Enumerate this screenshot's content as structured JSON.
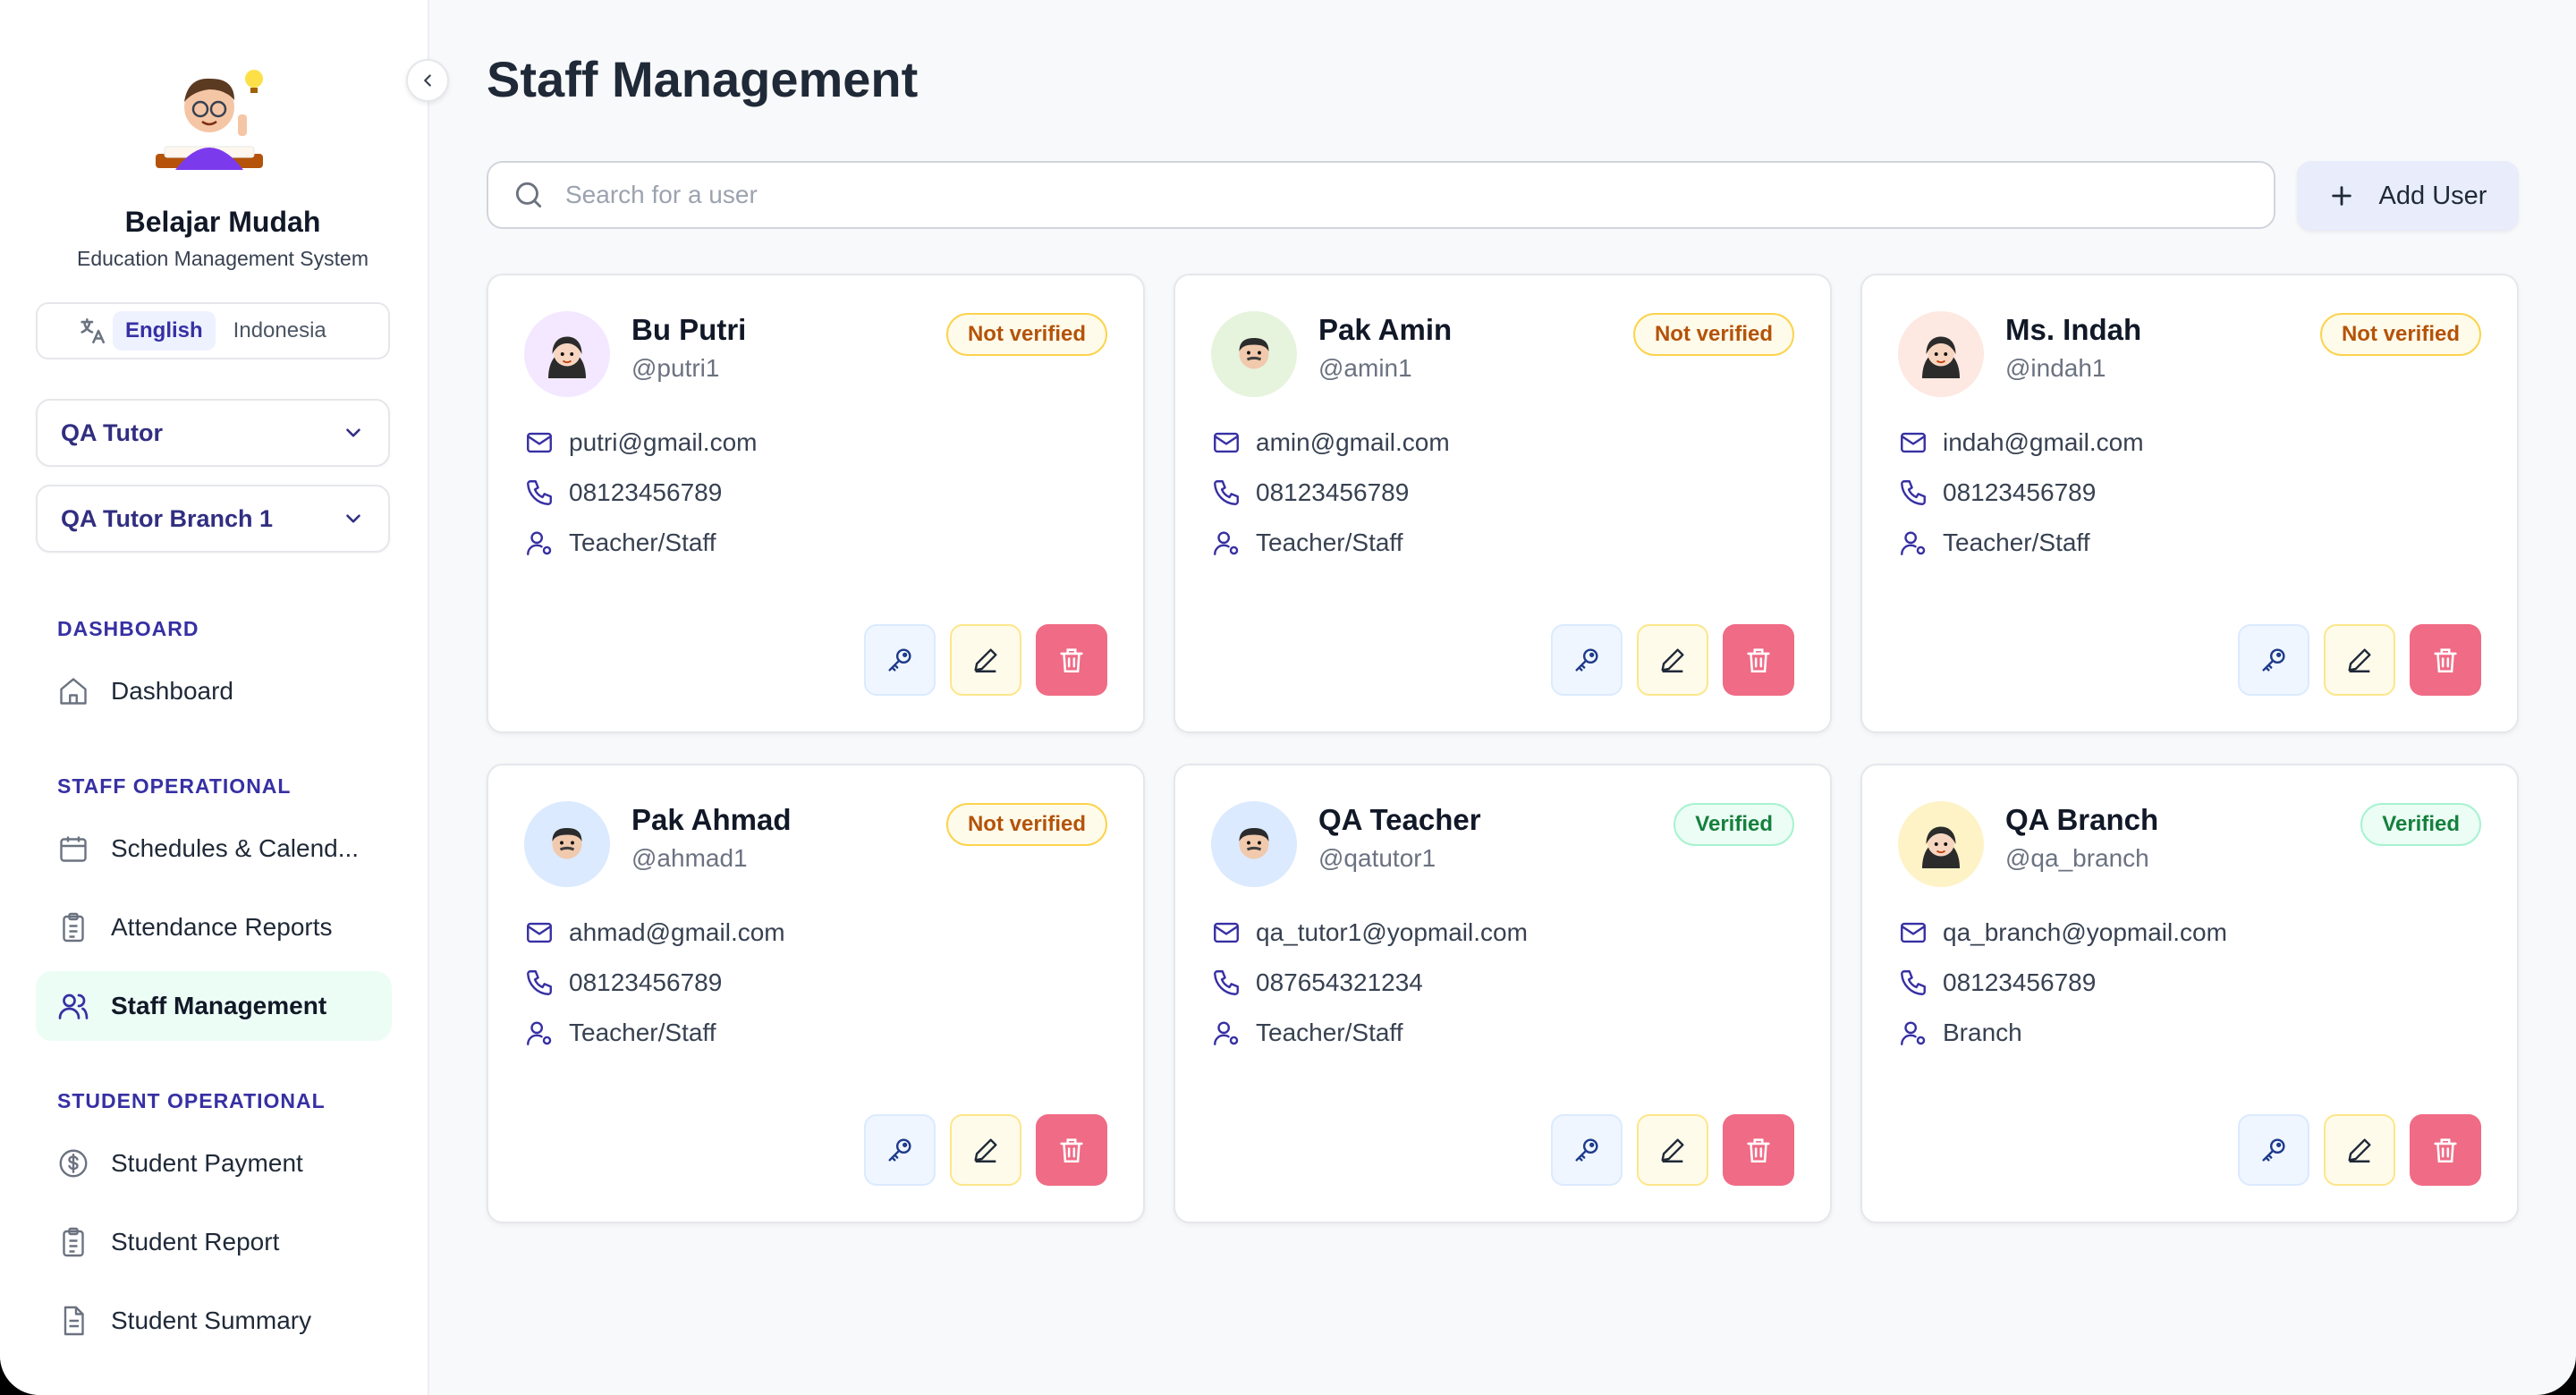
{
  "brand": {
    "name": "Belajar Mudah",
    "subtitle": "Education Management System"
  },
  "language": {
    "options": [
      "English",
      "Indonesia"
    ],
    "selected": "English"
  },
  "selectors": {
    "tutor": "QA Tutor",
    "branch": "QA Tutor Branch 1"
  },
  "sidebar": {
    "sections": [
      {
        "title": "DASHBOARD",
        "items": [
          {
            "label": "Dashboard",
            "icon": "home-icon"
          }
        ]
      },
      {
        "title": "STAFF OPERATIONAL",
        "items": [
          {
            "label": "Schedules & Calend...",
            "icon": "calendar-icon"
          },
          {
            "label": "Attendance Reports",
            "icon": "clipboard-icon"
          },
          {
            "label": "Staff Management",
            "icon": "users-icon",
            "active": true
          }
        ]
      },
      {
        "title": "STUDENT OPERATIONAL",
        "items": [
          {
            "label": "Student Payment",
            "icon": "dollar-icon"
          },
          {
            "label": "Student Report",
            "icon": "clipboard-icon"
          },
          {
            "label": "Student Summary",
            "icon": "document-icon"
          }
        ]
      }
    ]
  },
  "page": {
    "title": "Staff Management"
  },
  "search": {
    "placeholder": "Search for a user"
  },
  "add_button": {
    "label": "Add User"
  },
  "staff": [
    {
      "name": "Bu Putri",
      "username": "@putri1",
      "email": "putri@gmail.com",
      "phone": "08123456789",
      "role": "Teacher/Staff",
      "status": "Not verified",
      "avatar_bg": "#f3e8ff",
      "avatar": "female"
    },
    {
      "name": "Pak Amin",
      "username": "@amin1",
      "email": "amin@gmail.com",
      "phone": "08123456789",
      "role": "Teacher/Staff",
      "status": "Not verified",
      "avatar_bg": "#e6f4dd",
      "avatar": "male"
    },
    {
      "name": "Ms. Indah",
      "username": "@indah1",
      "email": "indah@gmail.com",
      "phone": "08123456789",
      "role": "Teacher/Staff",
      "status": "Not verified",
      "avatar_bg": "#fde8e2",
      "avatar": "female"
    },
    {
      "name": "Pak Ahmad",
      "username": "@ahmad1",
      "email": "ahmad@gmail.com",
      "phone": "08123456789",
      "role": "Teacher/Staff",
      "status": "Not verified",
      "avatar_bg": "#dbeafe",
      "avatar": "male"
    },
    {
      "name": "QA Teacher",
      "username": "@qatutor1",
      "email": "qa_tutor1@yopmail.com",
      "phone": "087654321234",
      "role": "Teacher/Staff",
      "status": "Verified",
      "avatar_bg": "#dbeafe",
      "avatar": "male"
    },
    {
      "name": "QA Branch",
      "username": "@qa_branch",
      "email": "qa_branch@yopmail.com",
      "phone": "08123456789",
      "role": "Branch",
      "status": "Verified",
      "avatar_bg": "#fef3c7",
      "avatar": "female"
    }
  ],
  "colors": {
    "accent": "#3730a3",
    "delete": "#f06b85",
    "active_nav": "#ecfdf5"
  }
}
